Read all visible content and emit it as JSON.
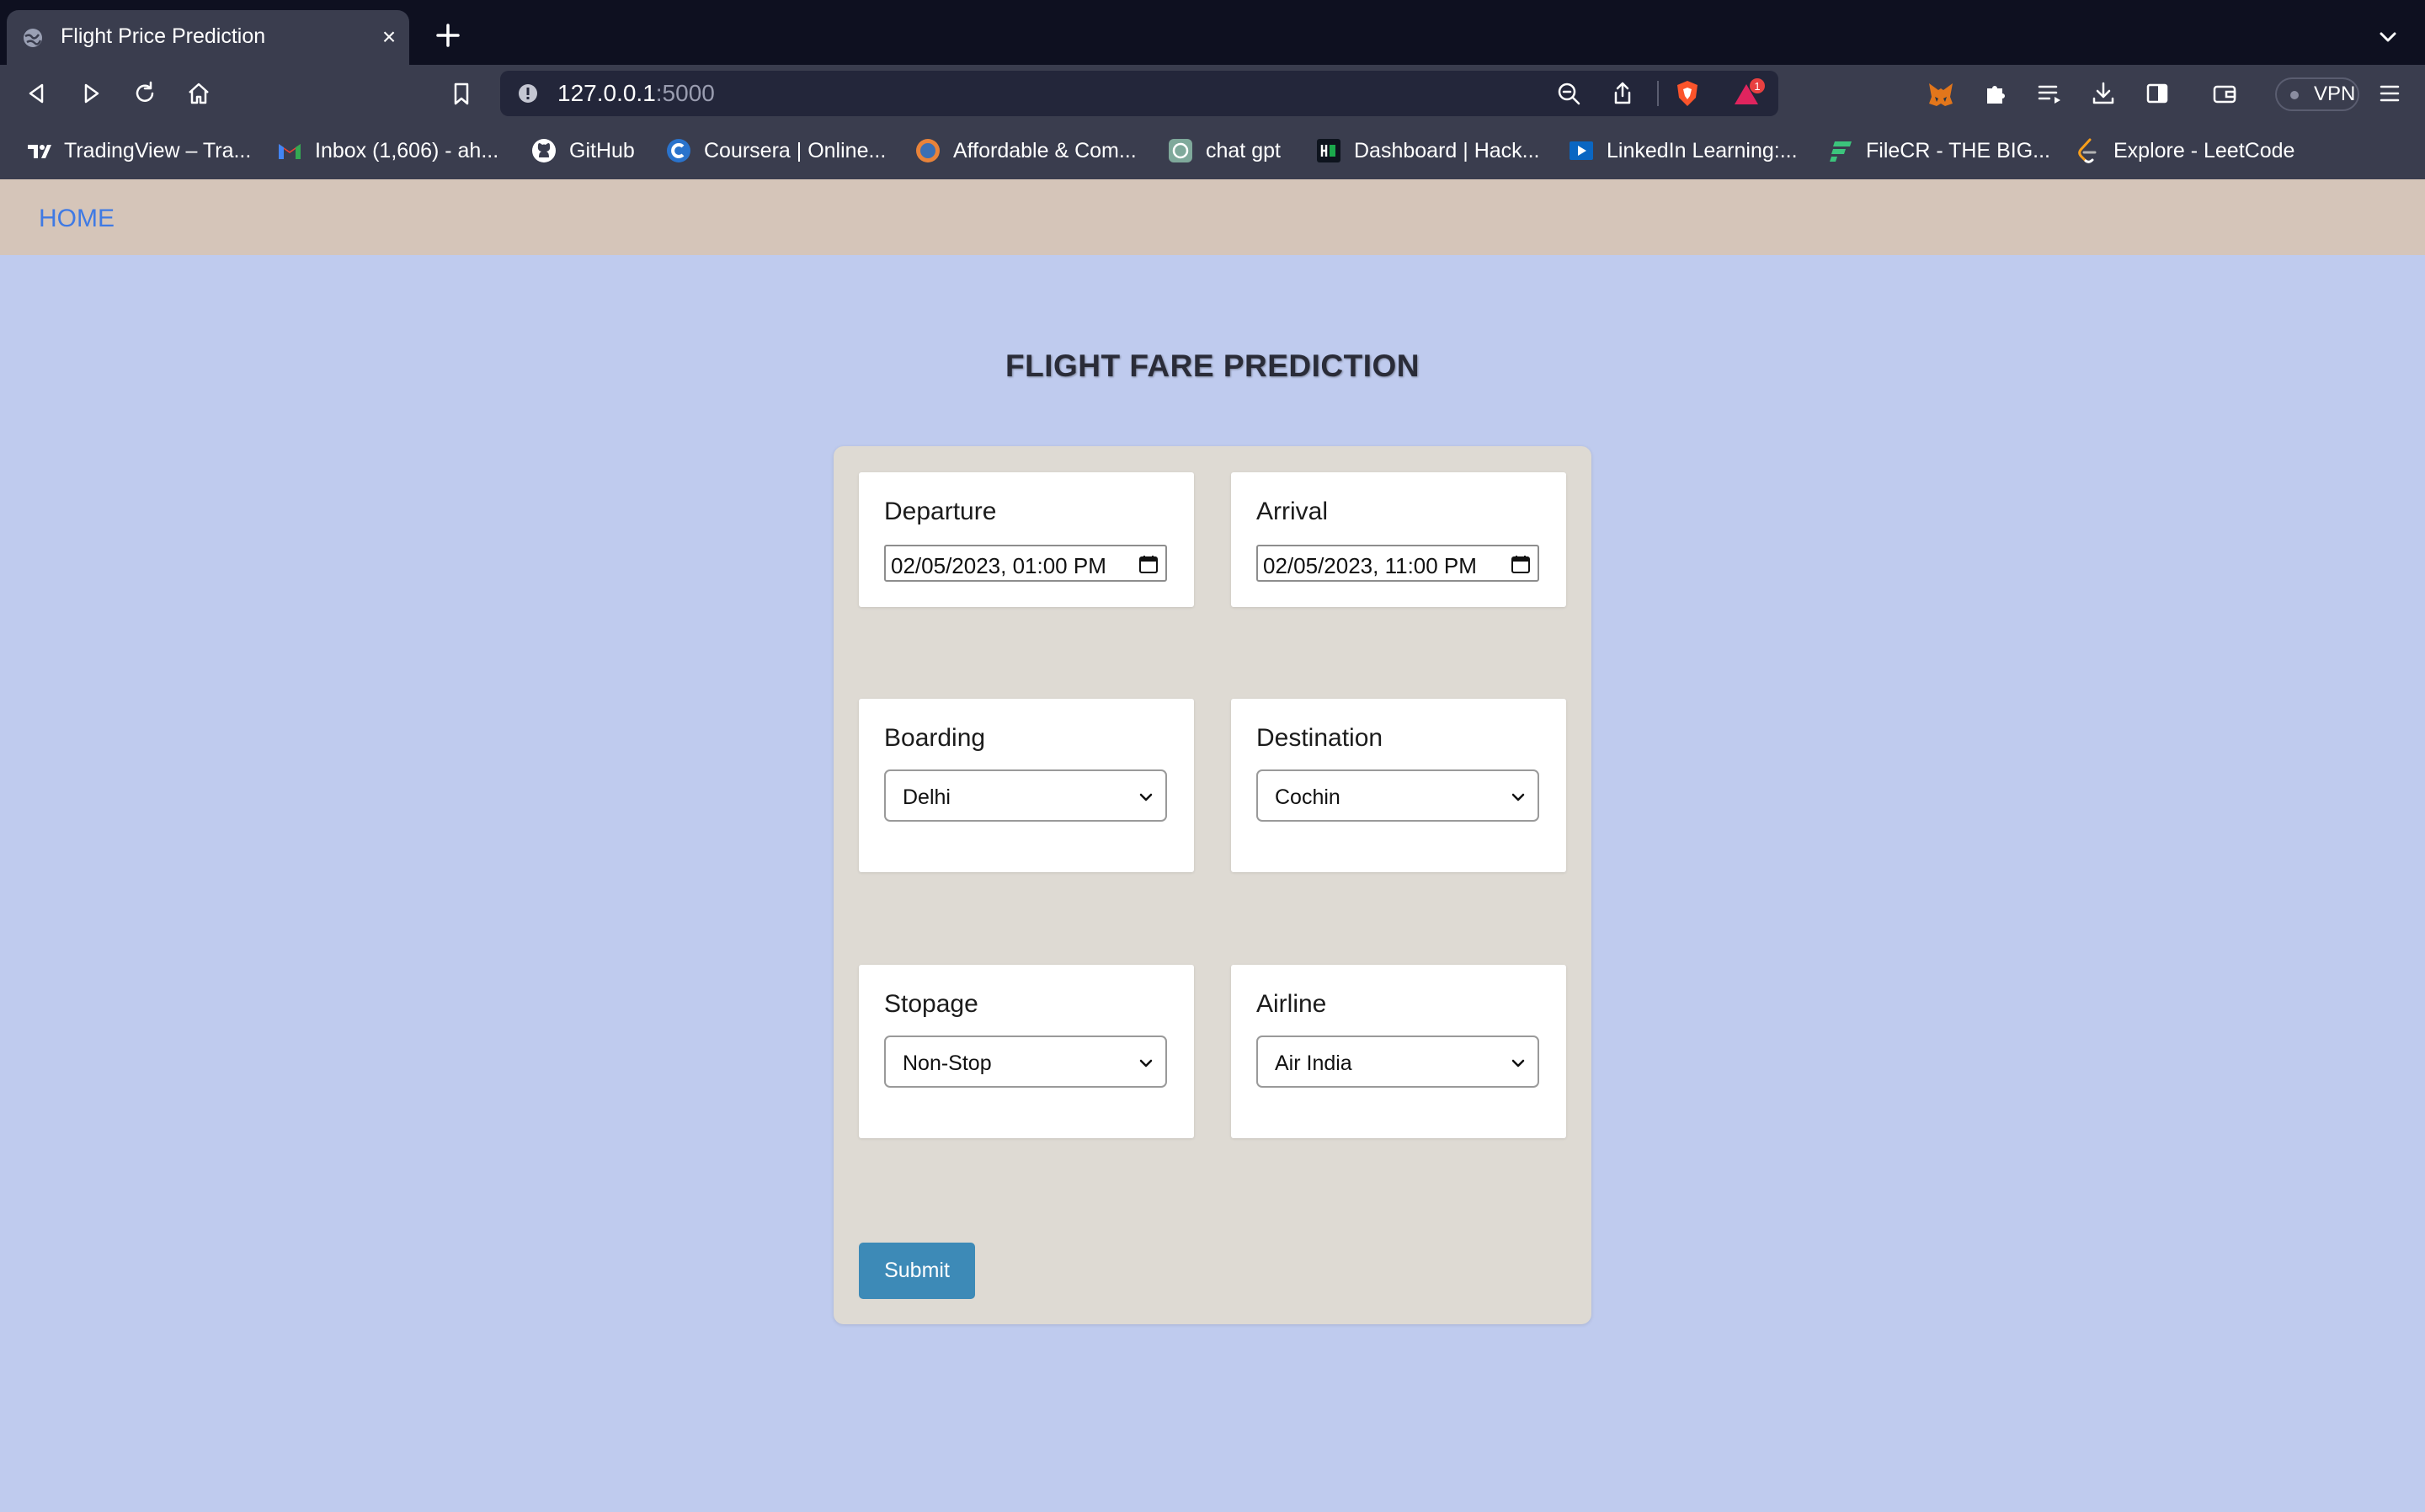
{
  "browser": {
    "tab_title": "Flight Price Prediction",
    "tab_close": "×",
    "url": {
      "host": "127.0.0.1",
      "port": ":5000"
    },
    "vpn_label": "VPN",
    "shields_badge": "1",
    "bookmarks": [
      {
        "label": "TradingView – Tra...",
        "icon": "tradingview-icon",
        "color": "#ffffff"
      },
      {
        "label": "Inbox (1,606) - ah...",
        "icon": "gmail-icon",
        "color": "#ea4335"
      },
      {
        "label": "GitHub",
        "icon": "github-icon",
        "color": "#ffffff"
      },
      {
        "label": "Coursera | Online...",
        "icon": "coursera-icon",
        "color": "#2a73cc"
      },
      {
        "label": "Affordable & Com...",
        "icon": "globe-icon",
        "color": "#e8833a"
      },
      {
        "label": "chat gpt",
        "icon": "chatgpt-icon",
        "color": "#7fa99b"
      },
      {
        "label": "Dashboard | Hack...",
        "icon": "hackerrank-icon",
        "color": "#1ba94c"
      },
      {
        "label": "LinkedIn Learning:...",
        "icon": "linkedin-learning-icon",
        "color": "#0a66c2"
      },
      {
        "label": "FileCR - THE BIG...",
        "icon": "filecr-icon",
        "color": "#3cc47c"
      },
      {
        "label": "Explore - LeetCode",
        "icon": "leetcode-icon",
        "color": "#f89f1b"
      }
    ]
  },
  "nav": {
    "home_label": "HOME"
  },
  "page": {
    "title": "FLIGHT FARE PREDICTION"
  },
  "form": {
    "departure": {
      "label": "Departure",
      "value": "02/05/2023, 01:00 PM"
    },
    "arrival": {
      "label": "Arrival",
      "value": "02/05/2023, 11:00 PM"
    },
    "boarding": {
      "label": "Boarding",
      "selected": "Delhi"
    },
    "destination": {
      "label": "Destination",
      "selected": "Cochin"
    },
    "stopage": {
      "label": "Stopage",
      "selected": "Non-Stop"
    },
    "airline": {
      "label": "Airline",
      "selected": "Air India"
    },
    "submit_label": "Submit"
  },
  "colors": {
    "page_bg": "#bfcbee",
    "navbar_bg": "#d5c5b9",
    "panel_bg": "#dedad3",
    "submit_bg": "#3d8ab7",
    "home_link": "#3f7ae4"
  }
}
